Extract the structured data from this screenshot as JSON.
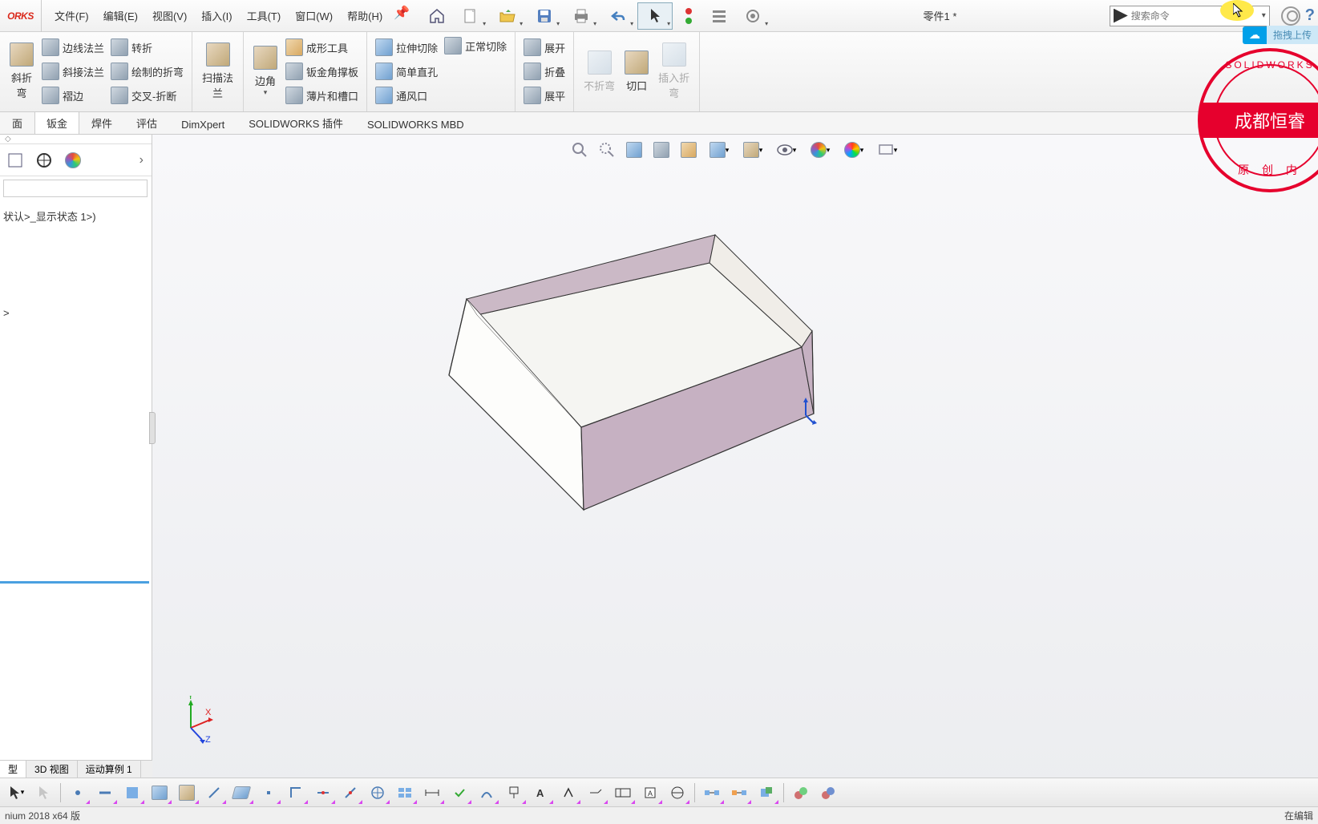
{
  "app": {
    "logo": "ORKS",
    "doc_title": "零件1 *"
  },
  "menu": {
    "file": "文件(F)",
    "edit": "编辑(E)",
    "view": "视图(V)",
    "insert": "插入(I)",
    "tools": "工具(T)",
    "window": "窗口(W)",
    "help": "帮助(H)"
  },
  "search": {
    "placeholder": "搜索命令"
  },
  "cloud_tag": "拖拽上传",
  "ribbon": {
    "g1": {
      "big1": "斜折\n弯",
      "r1": "边线法兰",
      "r2": "斜接法兰",
      "r3": "褶边",
      "r4": "转折",
      "r5": "绘制的折弯",
      "r6": "交叉-折断"
    },
    "g2": {
      "big": "扫描法\n兰"
    },
    "g3": {
      "big": "边角",
      "r1": "成形工具",
      "r2": "钣金角撑板",
      "r3": "薄片和槽口"
    },
    "g4": {
      "r1": "拉伸切除",
      "r2": "简单直孔",
      "r3": "通风口",
      "r4": "正常切除"
    },
    "g5": {
      "r1": "展开",
      "r2": "折叠",
      "r3": "展平"
    },
    "g6": {
      "b1": "不折弯",
      "b2": "切口",
      "b3": "插入折\n弯"
    }
  },
  "tabs": {
    "t1": "面",
    "t2": "钣金",
    "t3": "焊件",
    "t4": "评估",
    "t5": "DimXpert",
    "t6": "SOLIDWORKS 插件",
    "t7": "SOLIDWORKS MBD"
  },
  "tree": {
    "state": "状认>_显示状态 1>)",
    "arrow": ">"
  },
  "bottom_tabs": {
    "t1": "型",
    "t2": "3D 视图",
    "t3": "运动算例 1"
  },
  "status": {
    "left": "nium 2018 x64 版",
    "right": "在编辑"
  },
  "stamp": {
    "top": "SOLIDWORKS",
    "mid": "成都恒睿",
    "bot": "原 创 内"
  },
  "triad": {
    "x": "X",
    "y": "Y",
    "z": "Z"
  }
}
